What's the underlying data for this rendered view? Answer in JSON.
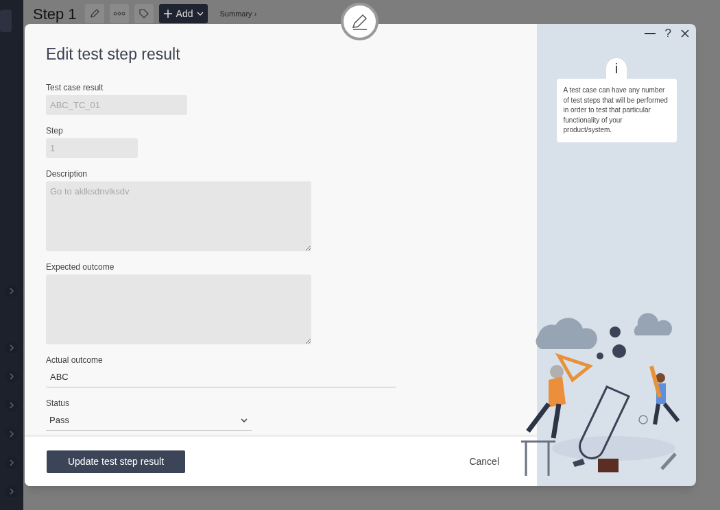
{
  "page": {
    "title": "Step 1",
    "add_button": "Add",
    "breadcrumb": "Summary ›"
  },
  "dialog": {
    "title": "Edit test step result",
    "fields": [
      {
        "kind": "input",
        "label": "Test case result",
        "value": "ABC_TC_01",
        "disabled": true
      },
      {
        "kind": "input",
        "label": "Step",
        "value": "1",
        "disabled": true
      },
      {
        "kind": "textarea",
        "label": "Description",
        "value": "Go to aklksdnvlksdv",
        "disabled": true
      },
      {
        "kind": "textarea",
        "label": "Expected outcome",
        "disabled": true
      },
      {
        "kind": "input",
        "label": "Actual outcome",
        "value": "ABC",
        "disabled": false
      },
      {
        "kind": "select",
        "label": "Status",
        "value": "Pass",
        "disabled": false
      }
    ],
    "primary_button": "Update test step result",
    "cancel_button": "Cancel",
    "window_buttons": {
      "help": "?"
    },
    "info_badge": "i",
    "info_text": "A test case can have any number of test steps that will be performed in order to test that particular functionality of your product/system."
  }
}
